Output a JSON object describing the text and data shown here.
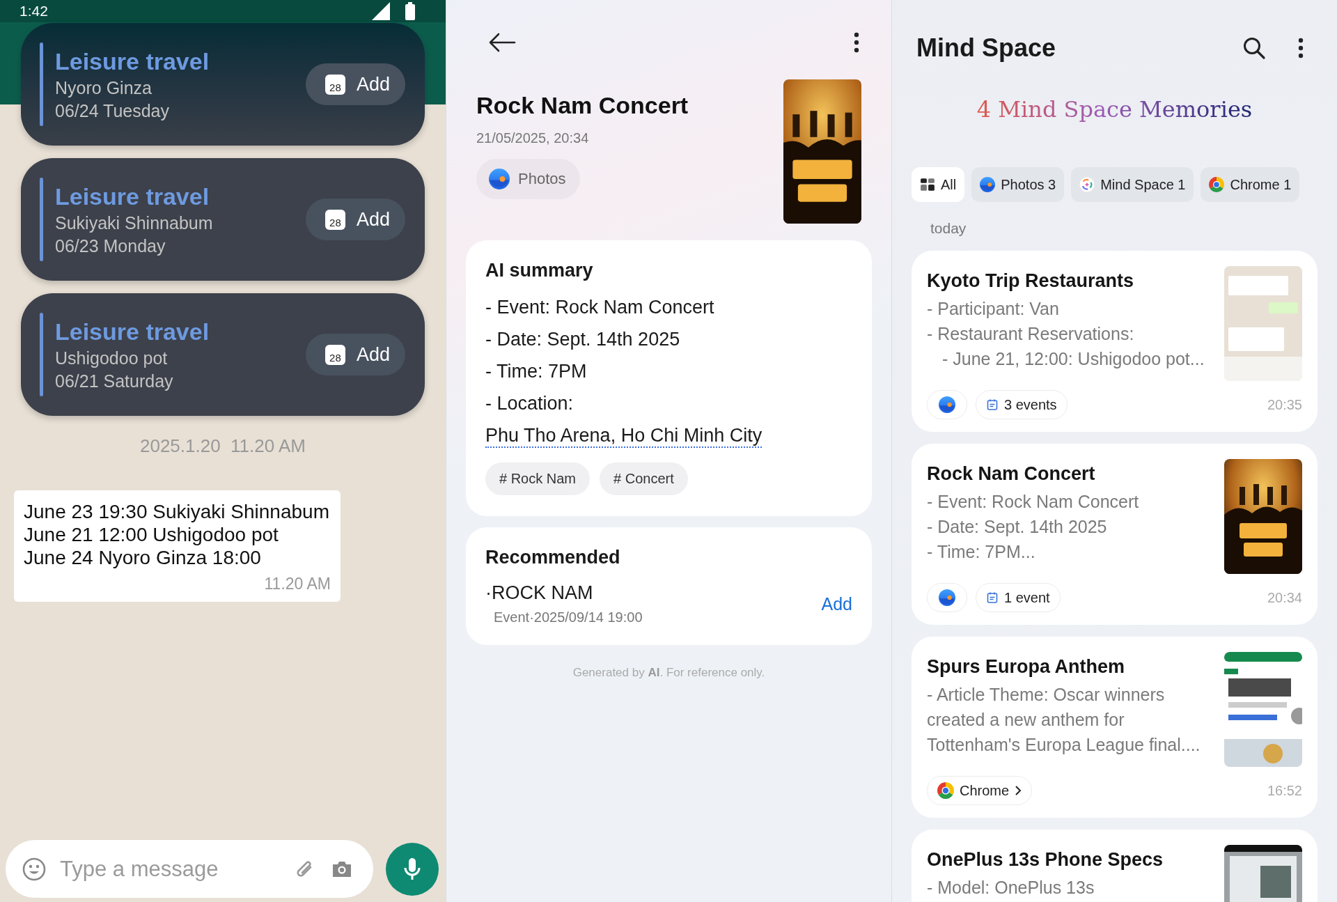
{
  "chat_screen": {
    "status_bar": {
      "time": "1:42"
    },
    "event_cards": [
      {
        "title": "Leisure travel",
        "place": "Nyoro Ginza",
        "date": "06/24 Tuesday",
        "calendar_day": "28",
        "button": "Add"
      },
      {
        "title": "Leisure travel",
        "place": "Sukiyaki Shinnabum",
        "date": "06/23 Monday",
        "calendar_day": "28",
        "button": "Add"
      },
      {
        "title": "Leisure travel",
        "place": "Ushigodoo pot",
        "date": "06/21 Saturday",
        "calendar_day": "28",
        "button": "Add"
      }
    ],
    "date_separator": "2025.1.20  11.20 AM",
    "message": {
      "lines": [
        "June 23 19:30 Sukiyaki Shinnabum",
        "June 21 12:00 Ushigodoo pot",
        "June 24 Nyoro Ginza 18:00"
      ],
      "time": "11.20 AM"
    },
    "composer": {
      "placeholder": "Type a message"
    }
  },
  "detail_screen": {
    "title": "Rock Nam Concert",
    "timestamp": "21/05/2025, 20:34",
    "source_chip": "Photos",
    "poster": {
      "kind": "picture"
    },
    "ai_summary": {
      "heading": "AI summary",
      "lines": [
        {
          "text": "- Event: Rock Nam Concert"
        },
        {
          "text": "- Date: Sept. 14th 2025"
        },
        {
          "text": "- Time: 7PM"
        },
        {
          "text": "- Location: ",
          "link": "Phu Tho Arena, Ho Chi Minh City"
        }
      ],
      "tags": [
        "# Rock Nam",
        "# Concert"
      ]
    },
    "recommended": {
      "heading": "Recommended",
      "items": [
        {
          "title": "·ROCK NAM",
          "subtitle": "Event·2025/09/14 19:00",
          "action": "Add"
        }
      ]
    },
    "footer": "Generated by **AI**. For reference only."
  },
  "mind_space_screen": {
    "title": "Mind Space",
    "banner": "4 Mind Space Memories",
    "filters": [
      {
        "kind": "all",
        "label": "All",
        "selected": true
      },
      {
        "kind": "photos",
        "label": "Photos 3",
        "selected": false
      },
      {
        "kind": "mindspace",
        "label": "Mind Space 1",
        "selected": false
      },
      {
        "kind": "chrome",
        "label": "Chrome 1",
        "selected": false
      }
    ],
    "section": "today",
    "memories": [
      {
        "title": "Kyoto Trip Restaurants",
        "lines": [
          {
            "text": "- Participant: Van"
          },
          {
            "text": "- Restaurant Reservations:",
            "children": [
              {
                "text": "- June 21, 12:00: Ushigodoo pot..."
              }
            ]
          }
        ],
        "chips": [
          {
            "kind": "photos"
          },
          {
            "kind": "events",
            "label": "3 events"
          }
        ],
        "time": "20:35",
        "thumbnail": {
          "kind": "picture"
        }
      },
      {
        "title": "Rock Nam Concert",
        "lines": [
          {
            "text": "- Event: Rock Nam Concert"
          },
          {
            "text": "- Date: Sept. 14th 2025"
          },
          {
            "text": "- Time: 7PM..."
          }
        ],
        "chips": [
          {
            "kind": "photos"
          },
          {
            "kind": "events",
            "label": "1 event"
          }
        ],
        "time": "20:34",
        "thumbnail": {
          "kind": "picture"
        }
      },
      {
        "title": "Spurs Europa Anthem",
        "lines": [
          {
            "text": "- Article Theme: Oscar winners created a new anthem for Tottenham's Europa League final...."
          }
        ],
        "chips": [
          {
            "kind": "chrome",
            "label": "Chrome"
          }
        ],
        "time": "16:52",
        "thumbnail": {
          "kind": "picture"
        }
      },
      {
        "title": "OnePlus 13s Phone Specs",
        "lines": [
          {
            "text": "- Model: OnePlus 13s"
          }
        ],
        "thumbnail": {
          "kind": "picture"
        }
      }
    ]
  }
}
